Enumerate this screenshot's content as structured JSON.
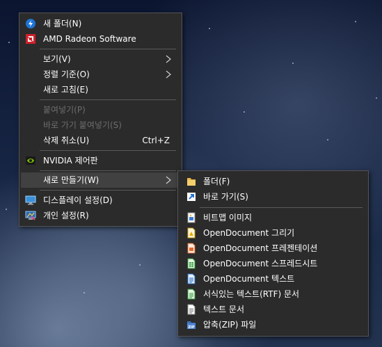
{
  "colors": {
    "menu_bg": "#2b2b2b",
    "highlight": "#414141",
    "text": "#ffffff",
    "disabled_text": "#6d6d6d",
    "separator": "#5a5a5a"
  },
  "context_menu": {
    "items": [
      {
        "label": "새 폴더(N)",
        "icon": "new-folder-icon"
      },
      {
        "label": "AMD Radeon Software",
        "icon": "amd-radeon-icon"
      },
      {
        "label": "보기(V)",
        "submenu": true
      },
      {
        "label": "정렬 기준(O)",
        "submenu": true
      },
      {
        "label": "새로 고침(E)"
      },
      {
        "label": "붙여넣기(P)",
        "disabled": true
      },
      {
        "label": "바로 가기 붙여넣기(S)",
        "disabled": true
      },
      {
        "label": "삭제 취소(U)",
        "shortcut": "Ctrl+Z"
      },
      {
        "label": "NVIDIA 제어판",
        "icon": "nvidia-icon"
      },
      {
        "label": "새로 만들기(W)",
        "submenu": true,
        "highlighted": true
      },
      {
        "label": "디스플레이 설정(D)",
        "icon": "display-settings-icon"
      },
      {
        "label": "개인 설정(R)",
        "icon": "personalize-icon"
      }
    ]
  },
  "new_submenu": {
    "items": [
      {
        "label": "폴더(F)",
        "icon": "folder-icon"
      },
      {
        "label": "바로 가기(S)",
        "icon": "shortcut-icon"
      },
      {
        "label": "비트맵 이미지",
        "icon": "bitmap-image-icon"
      },
      {
        "label": "OpenDocument 그리기",
        "icon": "odg-icon"
      },
      {
        "label": "OpenDocument 프레젠테이션",
        "icon": "odp-icon"
      },
      {
        "label": "OpenDocument 스프레드시트",
        "icon": "ods-icon"
      },
      {
        "label": "OpenDocument 텍스트",
        "icon": "odt-icon"
      },
      {
        "label": "서식있는 텍스트(RTF) 문서",
        "icon": "rtf-document-icon"
      },
      {
        "label": "텍스트 문서",
        "icon": "text-document-icon"
      },
      {
        "label": "압축(ZIP) 파일",
        "icon": "zip-file-icon"
      }
    ]
  }
}
